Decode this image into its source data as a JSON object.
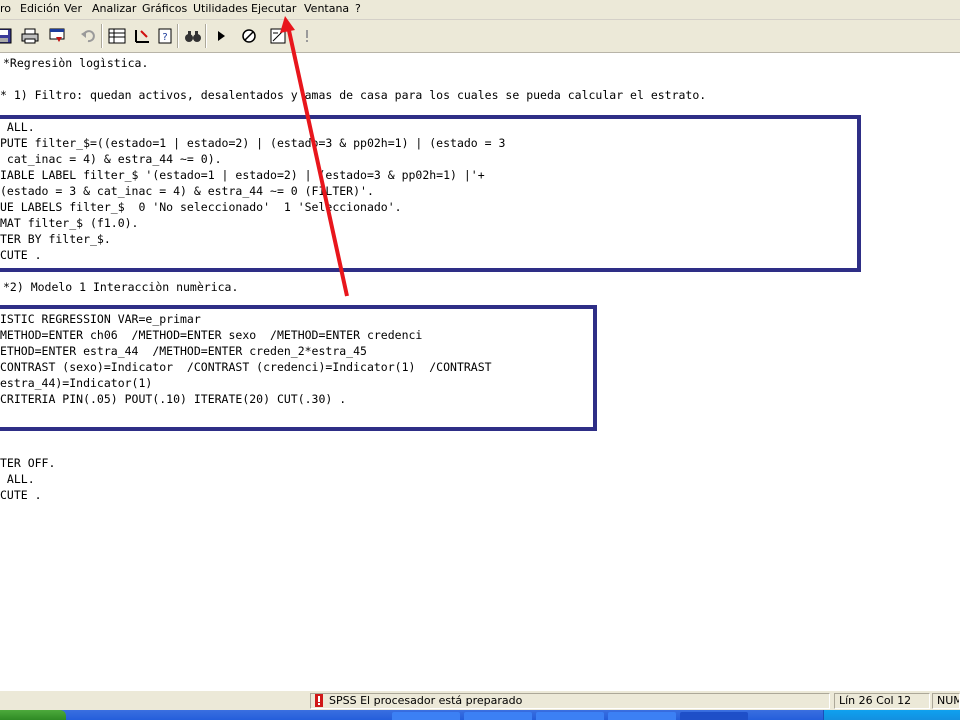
{
  "menu": [
    "ro",
    "Edición",
    "Ver",
    "Analizar",
    "Gráficos",
    "Utilidades",
    "Ejecutar",
    "Ventana",
    "?"
  ],
  "toolbar_icons": [
    "save-icon",
    "print-icon",
    "dialog-recall-icon",
    "undo-icon",
    "goto-case-icon",
    "variables-icon",
    "help-icon",
    "find-icon",
    "run-icon",
    "stop-icon",
    "syntax-icon",
    "info-icon"
  ],
  "code": [
    "*Regresiòn logìstica.",
    "",
    "* 1) Filtro: quedan activos, desalentados y amas de casa para los cuales se pueda calcular el estrato.",
    "",
    " ALL.",
    "PUTE filter_$=((estado=1 | estado=2) | (estado=3 & pp02h=1) | (estado = 3",
    " cat_inac = 4) & estra_44 ~= 0).",
    "IABLE LABEL filter_$ '(estado=1 | estado=2) | (estado=3 & pp02h=1) |'+",
    "(estado = 3 & cat_inac = 4) & estra_44 ~= 0 (FILTER)'.",
    "UE LABELS filter_$  0 'No seleccionado'  1 'Seleccionado'.",
    "MAT filter_$ (f1.0).",
    "TER BY filter_$.",
    "CUTE .",
    "",
    "*2) Modelo 1 Interacciòn numèrica.",
    "",
    "ISTIC REGRESSION VAR=e_primar",
    "METHOD=ENTER ch06  /METHOD=ENTER sexo  /METHOD=ENTER credenci",
    "ETHOD=ENTER estra_44  /METHOD=ENTER creden_2*estra_45",
    "CONTRAST (sexo)=Indicator  /CONTRAST (credenci)=Indicator(1)  /CONTRAST",
    "estra_44)=Indicator(1)",
    "CRITERIA PIN(.05) POUT(.10) ITERATE(20) CUT(.30) .",
    "",
    "",
    "",
    "TER OFF.",
    " ALL.",
    "CUTE ."
  ],
  "status": {
    "processor": "SPSS El procesador  está preparado",
    "position": "Lín 26 Col 12",
    "num": "NUM"
  },
  "colors": {
    "highlight_box": "#2e2e86",
    "arrow": "#e8161c"
  }
}
